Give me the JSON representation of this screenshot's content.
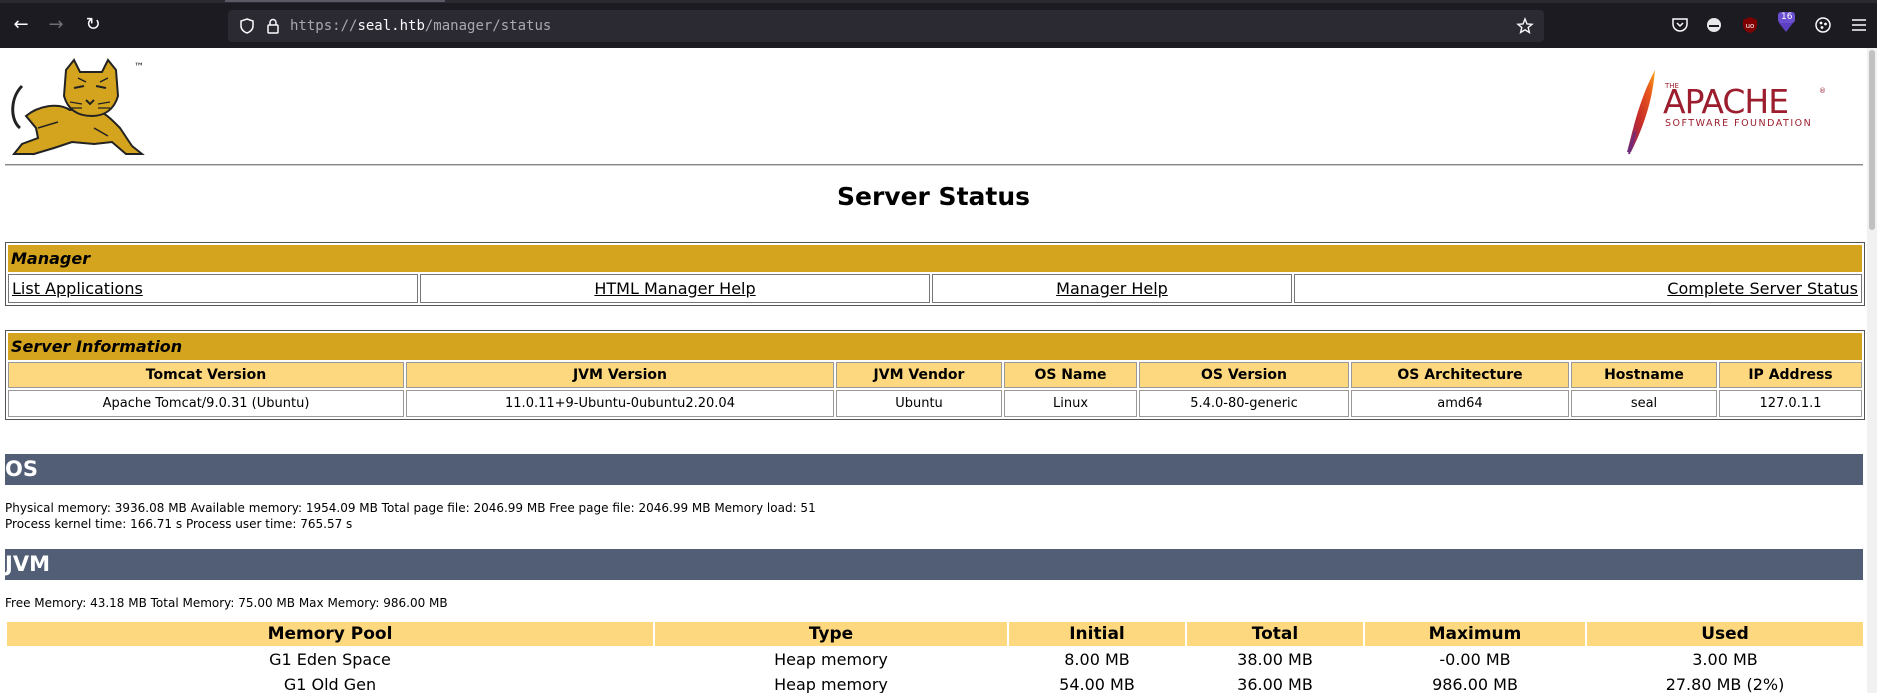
{
  "browser": {
    "url_prefix": "https://",
    "url_host": "seal.htb",
    "url_path": "/manager/status",
    "extension_badge": "16"
  },
  "header": {
    "tomcat_tm": "™",
    "apache_the": "THE",
    "apache_name": "APACHE",
    "apache_sub": "SOFTWARE FOUNDATION",
    "apache_reg": "®"
  },
  "page_title": "Server Status",
  "manager": {
    "heading": "Manager",
    "links": [
      "List Applications",
      "HTML Manager Help",
      "Manager Help",
      "Complete Server Status"
    ]
  },
  "server_info": {
    "heading": "Server Information",
    "columns": [
      "Tomcat Version",
      "JVM Version",
      "JVM Vendor",
      "OS Name",
      "OS Version",
      "OS Architecture",
      "Hostname",
      "IP Address"
    ],
    "values": [
      "Apache Tomcat/9.0.31 (Ubuntu)",
      "11.0.11+9-Ubuntu-0ubuntu2.20.04",
      "Ubuntu",
      "Linux",
      "5.4.0-80-generic",
      "amd64",
      "seal",
      "127.0.1.1"
    ]
  },
  "os": {
    "heading": "OS",
    "line1": "Physical memory: 3936.08 MB Available memory: 1954.09 MB Total page file: 2046.99 MB Free page file: 2046.99 MB Memory load: 51",
    "line2": "Process kernel time: 166.71 s Process user time: 765.57 s"
  },
  "jvm": {
    "heading": "JVM",
    "line1": "Free Memory: 43.18 MB Total Memory: 75.00 MB Max Memory: 986.00 MB",
    "columns": [
      "Memory Pool",
      "Type",
      "Initial",
      "Total",
      "Maximum",
      "Used"
    ],
    "rows": [
      [
        "G1 Eden Space",
        "Heap memory",
        "8.00 MB",
        "38.00 MB",
        "-0.00 MB",
        "3.00 MB"
      ],
      [
        "G1 Old Gen",
        "Heap memory",
        "54.00 MB",
        "36.00 MB",
        "986.00 MB",
        "27.80 MB (2%)"
      ]
    ]
  }
}
